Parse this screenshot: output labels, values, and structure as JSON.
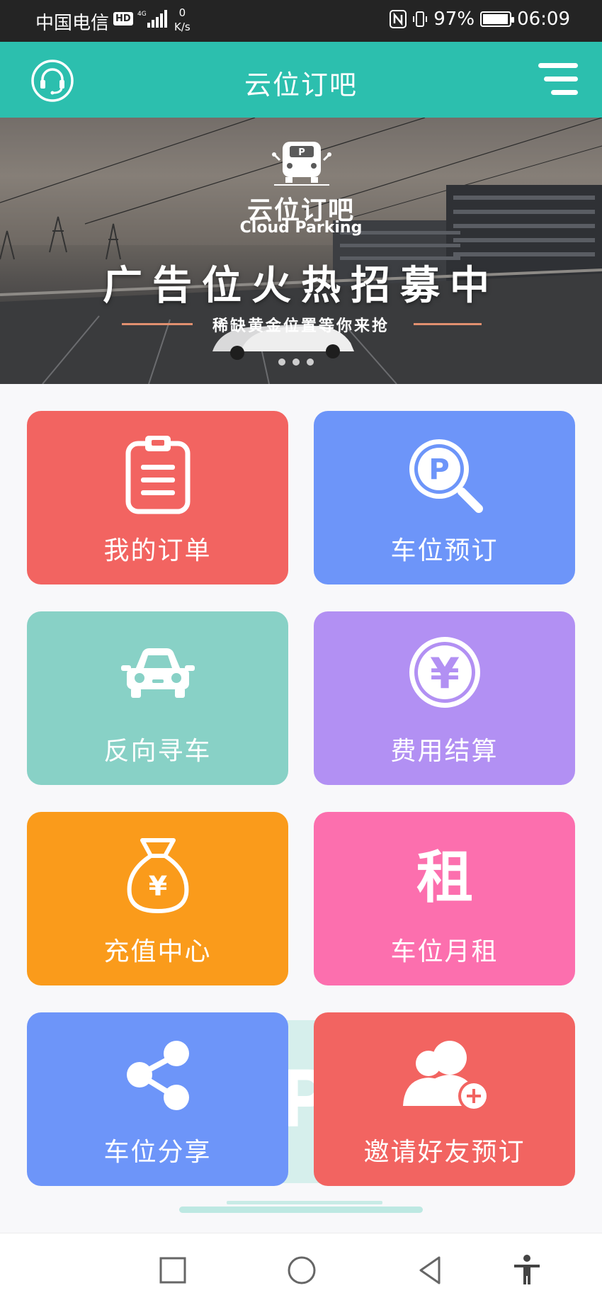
{
  "status_bar": {
    "carrier": "中国电信",
    "hd": "HD",
    "network": "4G",
    "speed_value": "0",
    "speed_unit": "K/s",
    "battery": "97%",
    "battery_level": 0.97,
    "time": "06:09"
  },
  "header": {
    "title": "云位订吧",
    "support_icon": "headset-icon",
    "menu_icon": "menu-icon"
  },
  "banner": {
    "brand_cn": "云位订吧",
    "brand_en": "Cloud Parking",
    "headline": "广告位火热招募中",
    "subline": "稀缺黄金位置等你来抢",
    "slides_total": 3
  },
  "tiles": [
    {
      "label": "我的订单",
      "icon": "clipboard-icon",
      "color": "#f26461"
    },
    {
      "label": "车位预订",
      "icon": "parking-search-icon",
      "color": "#6d95f9"
    },
    {
      "label": "反向寻车",
      "icon": "car-icon",
      "color": "#88d1c6"
    },
    {
      "label": "费用结算",
      "icon": "yen-circle-icon",
      "color": "#b290f3"
    },
    {
      "label": "充值中心",
      "icon": "money-bag-icon",
      "color": "#fa9b1b"
    },
    {
      "label": "车位月租",
      "icon": "rent-icon",
      "color": "#fc6fae"
    },
    {
      "label": "车位分享",
      "icon": "share-icon",
      "color": "#6d95f9"
    },
    {
      "label": "邀请好友预订",
      "icon": "invite-friends-icon",
      "color": "#f26461"
    }
  ],
  "icon_text": {
    "rent_char": "租",
    "yen": "¥",
    "parking_letter": "P"
  },
  "nav": {
    "recent_icon": "square-icon",
    "home_icon": "circle-icon",
    "back_icon": "triangle-back-icon",
    "accessibility_icon": "accessibility-icon"
  }
}
